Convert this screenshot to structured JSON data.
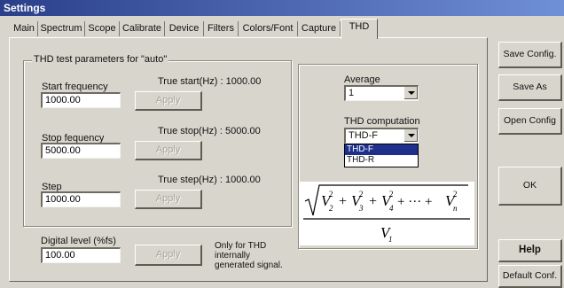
{
  "window": {
    "title": "Settings"
  },
  "tabs": [
    {
      "label": "Main"
    },
    {
      "label": "Spectrum"
    },
    {
      "label": "Scope"
    },
    {
      "label": "Calibrate"
    },
    {
      "label": "Device"
    },
    {
      "label": "Filters"
    },
    {
      "label": "Colors/Font"
    },
    {
      "label": "Capture"
    },
    {
      "label": "THD",
      "active": true
    }
  ],
  "thd_params": {
    "group_title": "THD test parameters for \"auto\"",
    "start": {
      "label": "Start frequency",
      "value": "1000.00",
      "true_text": "True start(Hz) : 1000.00",
      "apply": "Apply"
    },
    "stop": {
      "label": "Stop fequency",
      "value": "5000.00",
      "true_text": "True stop(Hz) : 5000.00",
      "apply": "Apply"
    },
    "step": {
      "label": "Step",
      "value": "1000.00",
      "true_text": "True step(Hz) : 1000.00",
      "apply": "Apply"
    }
  },
  "digital_level": {
    "label": "Digital level (%fs)",
    "value": "100.00",
    "apply": "Apply",
    "note": "Only for THD internally generated signal."
  },
  "average": {
    "label": "Average",
    "value": "1"
  },
  "thd_computation": {
    "label": "THD computation",
    "value": "THD-F",
    "options": [
      "THD-F",
      "THD-R"
    ],
    "highlighted": "THD-F"
  },
  "formula": {
    "numerator_terms": [
      "V",
      "2",
      "+",
      "V",
      "3",
      "+",
      "V",
      "4",
      "+ ··· +",
      "V",
      "n"
    ],
    "denominator": "V",
    "denominator_sub": "1"
  },
  "right_buttons": {
    "save_config": "Save Config.",
    "save_as": "Save As",
    "open_config": "Open Config",
    "ok": "OK",
    "help": "Help",
    "default_conf": "Default Conf."
  },
  "colors": {
    "titlebar_start": "#2a3f8a",
    "titlebar_end": "#6f8fd6",
    "selection": "#1f2f8c",
    "face": "#d7d5cc"
  }
}
